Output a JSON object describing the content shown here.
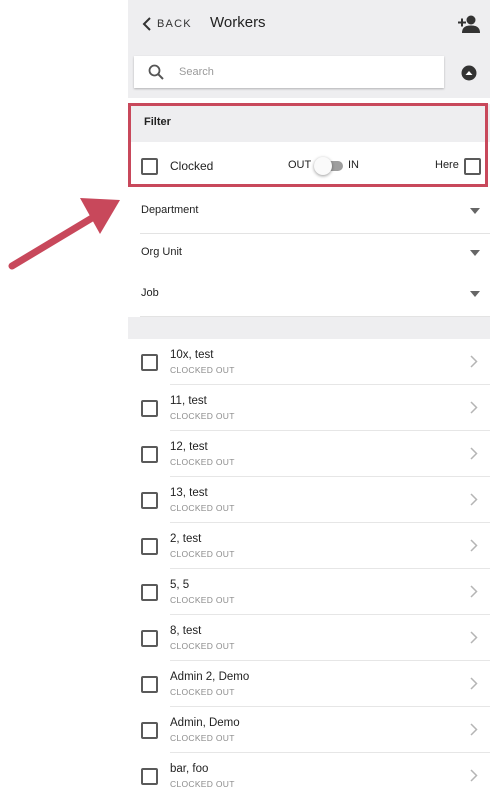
{
  "header": {
    "back_label": "BACK",
    "title": "Workers"
  },
  "search": {
    "placeholder": "Search"
  },
  "filter": {
    "title": "Filter",
    "clocked_label": "Clocked",
    "out_label": "OUT",
    "in_label": "IN",
    "here_label": "Here",
    "clocked_checked": false,
    "here_checked": false,
    "toggle_state": "OUT"
  },
  "dropdowns": [
    {
      "label": "Department"
    },
    {
      "label": "Org Unit"
    },
    {
      "label": "Job"
    }
  ],
  "workers": [
    {
      "name": "10x, test",
      "status": "CLOCKED OUT"
    },
    {
      "name": "11, test",
      "status": "CLOCKED OUT"
    },
    {
      "name": "12, test",
      "status": "CLOCKED OUT"
    },
    {
      "name": "13, test",
      "status": "CLOCKED OUT"
    },
    {
      "name": "2, test",
      "status": "CLOCKED OUT"
    },
    {
      "name": "5, 5",
      "status": "CLOCKED OUT"
    },
    {
      "name": "8, test",
      "status": "CLOCKED OUT"
    },
    {
      "name": "Admin 2, Demo",
      "status": "CLOCKED OUT"
    },
    {
      "name": "Admin, Demo",
      "status": "CLOCKED OUT"
    },
    {
      "name": "bar, foo",
      "status": "CLOCKED OUT"
    }
  ],
  "icons": {
    "back": "chevron-left-icon",
    "add_user": "add-user-icon",
    "search": "search-icon",
    "collapse": "arrow-up-circle-icon",
    "dropdown": "caret-down-icon",
    "row": "chevron-right-icon"
  },
  "colors": {
    "header_bg": "#eeeef0",
    "highlight": "#c8485b",
    "arrow": "#c8485b",
    "toggle_track": "#9e9e9e"
  }
}
